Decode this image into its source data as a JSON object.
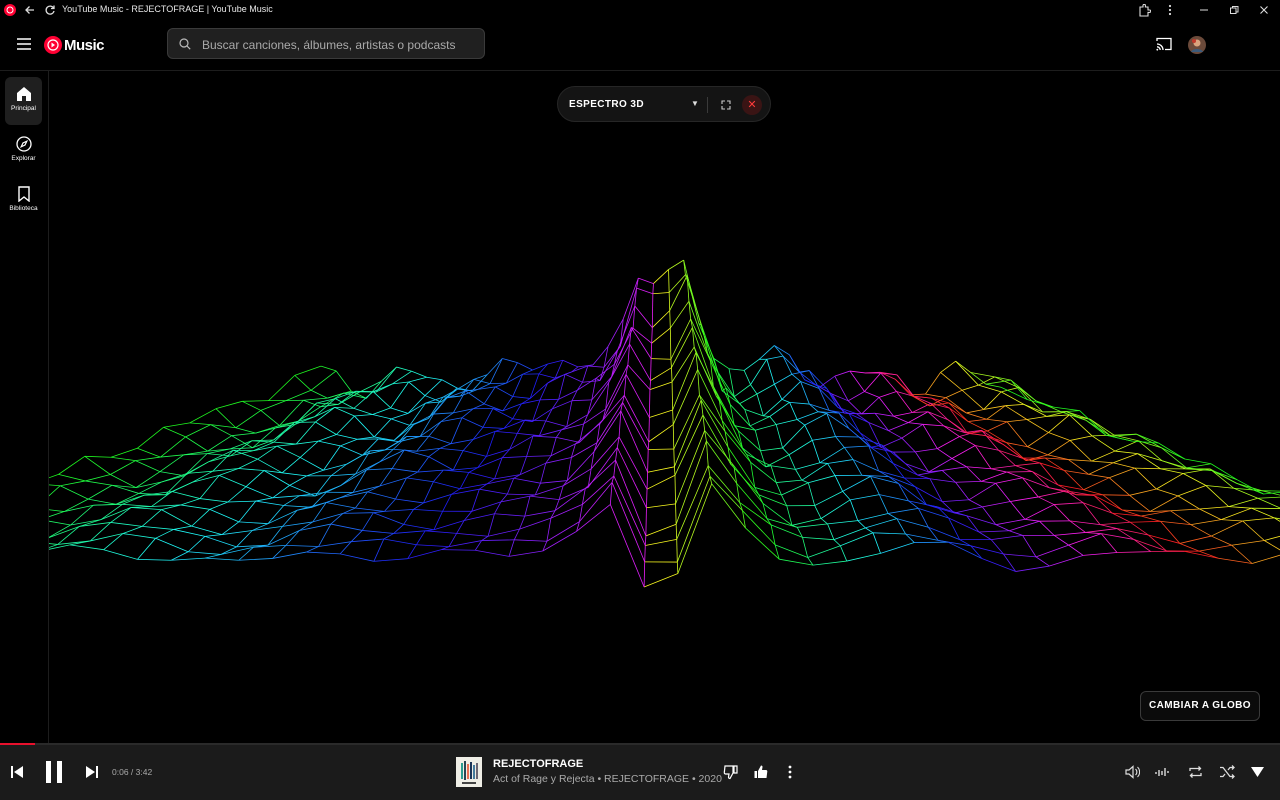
{
  "window": {
    "title": "YouTube Music - REJECTOFRAGE | YouTube Music"
  },
  "header": {
    "logo_text": "Music",
    "search_placeholder": "Buscar canciones, álbumes, artistas o podcasts"
  },
  "sidebar": {
    "items": [
      {
        "label": "Principal",
        "icon": "home-icon",
        "active": true
      },
      {
        "label": "Explorar",
        "icon": "compass-icon",
        "active": false
      },
      {
        "label": "Biblioteca",
        "icon": "bookmark-icon",
        "active": false
      }
    ]
  },
  "visualizer": {
    "mode_label": "ESPECTRO 3D",
    "switch_button": "CAMBIAR A GLOBO"
  },
  "player": {
    "time": "0:06 / 3:42",
    "progress": 0.027,
    "song_title": "REJECTOFRAGE",
    "song_meta": "Act of Rage y Rejecta • REJECTOFRAGE • 2020"
  },
  "colors": {
    "accent": "#ff0033",
    "progress": "#e8112d",
    "background": "#000000",
    "player_bg": "#1b1b1b"
  }
}
